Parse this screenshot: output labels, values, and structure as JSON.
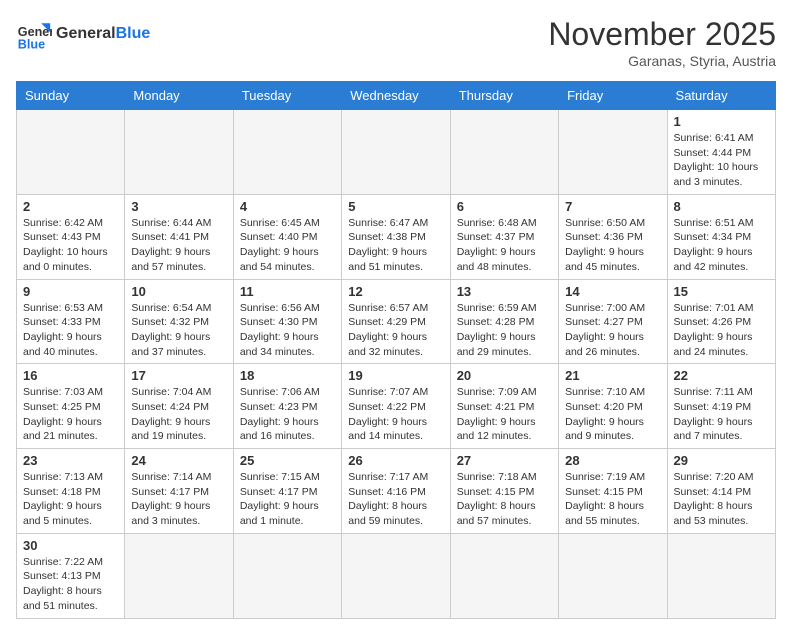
{
  "logo": {
    "text_general": "General",
    "text_blue": "Blue"
  },
  "header": {
    "month": "November 2025",
    "location": "Garanas, Styria, Austria"
  },
  "days_of_week": [
    "Sunday",
    "Monday",
    "Tuesday",
    "Wednesday",
    "Thursday",
    "Friday",
    "Saturday"
  ],
  "weeks": [
    [
      {
        "day": "",
        "info": ""
      },
      {
        "day": "",
        "info": ""
      },
      {
        "day": "",
        "info": ""
      },
      {
        "day": "",
        "info": ""
      },
      {
        "day": "",
        "info": ""
      },
      {
        "day": "",
        "info": ""
      },
      {
        "day": "1",
        "info": "Sunrise: 6:41 AM\nSunset: 4:44 PM\nDaylight: 10 hours and 3 minutes."
      }
    ],
    [
      {
        "day": "2",
        "info": "Sunrise: 6:42 AM\nSunset: 4:43 PM\nDaylight: 10 hours and 0 minutes."
      },
      {
        "day": "3",
        "info": "Sunrise: 6:44 AM\nSunset: 4:41 PM\nDaylight: 9 hours and 57 minutes."
      },
      {
        "day": "4",
        "info": "Sunrise: 6:45 AM\nSunset: 4:40 PM\nDaylight: 9 hours and 54 minutes."
      },
      {
        "day": "5",
        "info": "Sunrise: 6:47 AM\nSunset: 4:38 PM\nDaylight: 9 hours and 51 minutes."
      },
      {
        "day": "6",
        "info": "Sunrise: 6:48 AM\nSunset: 4:37 PM\nDaylight: 9 hours and 48 minutes."
      },
      {
        "day": "7",
        "info": "Sunrise: 6:50 AM\nSunset: 4:36 PM\nDaylight: 9 hours and 45 minutes."
      },
      {
        "day": "8",
        "info": "Sunrise: 6:51 AM\nSunset: 4:34 PM\nDaylight: 9 hours and 42 minutes."
      }
    ],
    [
      {
        "day": "9",
        "info": "Sunrise: 6:53 AM\nSunset: 4:33 PM\nDaylight: 9 hours and 40 minutes."
      },
      {
        "day": "10",
        "info": "Sunrise: 6:54 AM\nSunset: 4:32 PM\nDaylight: 9 hours and 37 minutes."
      },
      {
        "day": "11",
        "info": "Sunrise: 6:56 AM\nSunset: 4:30 PM\nDaylight: 9 hours and 34 minutes."
      },
      {
        "day": "12",
        "info": "Sunrise: 6:57 AM\nSunset: 4:29 PM\nDaylight: 9 hours and 32 minutes."
      },
      {
        "day": "13",
        "info": "Sunrise: 6:59 AM\nSunset: 4:28 PM\nDaylight: 9 hours and 29 minutes."
      },
      {
        "day": "14",
        "info": "Sunrise: 7:00 AM\nSunset: 4:27 PM\nDaylight: 9 hours and 26 minutes."
      },
      {
        "day": "15",
        "info": "Sunrise: 7:01 AM\nSunset: 4:26 PM\nDaylight: 9 hours and 24 minutes."
      }
    ],
    [
      {
        "day": "16",
        "info": "Sunrise: 7:03 AM\nSunset: 4:25 PM\nDaylight: 9 hours and 21 minutes."
      },
      {
        "day": "17",
        "info": "Sunrise: 7:04 AM\nSunset: 4:24 PM\nDaylight: 9 hours and 19 minutes."
      },
      {
        "day": "18",
        "info": "Sunrise: 7:06 AM\nSunset: 4:23 PM\nDaylight: 9 hours and 16 minutes."
      },
      {
        "day": "19",
        "info": "Sunrise: 7:07 AM\nSunset: 4:22 PM\nDaylight: 9 hours and 14 minutes."
      },
      {
        "day": "20",
        "info": "Sunrise: 7:09 AM\nSunset: 4:21 PM\nDaylight: 9 hours and 12 minutes."
      },
      {
        "day": "21",
        "info": "Sunrise: 7:10 AM\nSunset: 4:20 PM\nDaylight: 9 hours and 9 minutes."
      },
      {
        "day": "22",
        "info": "Sunrise: 7:11 AM\nSunset: 4:19 PM\nDaylight: 9 hours and 7 minutes."
      }
    ],
    [
      {
        "day": "23",
        "info": "Sunrise: 7:13 AM\nSunset: 4:18 PM\nDaylight: 9 hours and 5 minutes."
      },
      {
        "day": "24",
        "info": "Sunrise: 7:14 AM\nSunset: 4:17 PM\nDaylight: 9 hours and 3 minutes."
      },
      {
        "day": "25",
        "info": "Sunrise: 7:15 AM\nSunset: 4:17 PM\nDaylight: 9 hours and 1 minute."
      },
      {
        "day": "26",
        "info": "Sunrise: 7:17 AM\nSunset: 4:16 PM\nDaylight: 8 hours and 59 minutes."
      },
      {
        "day": "27",
        "info": "Sunrise: 7:18 AM\nSunset: 4:15 PM\nDaylight: 8 hours and 57 minutes."
      },
      {
        "day": "28",
        "info": "Sunrise: 7:19 AM\nSunset: 4:15 PM\nDaylight: 8 hours and 55 minutes."
      },
      {
        "day": "29",
        "info": "Sunrise: 7:20 AM\nSunset: 4:14 PM\nDaylight: 8 hours and 53 minutes."
      }
    ],
    [
      {
        "day": "30",
        "info": "Sunrise: 7:22 AM\nSunset: 4:13 PM\nDaylight: 8 hours and 51 minutes."
      },
      {
        "day": "",
        "info": ""
      },
      {
        "day": "",
        "info": ""
      },
      {
        "day": "",
        "info": ""
      },
      {
        "day": "",
        "info": ""
      },
      {
        "day": "",
        "info": ""
      },
      {
        "day": "",
        "info": ""
      }
    ]
  ]
}
